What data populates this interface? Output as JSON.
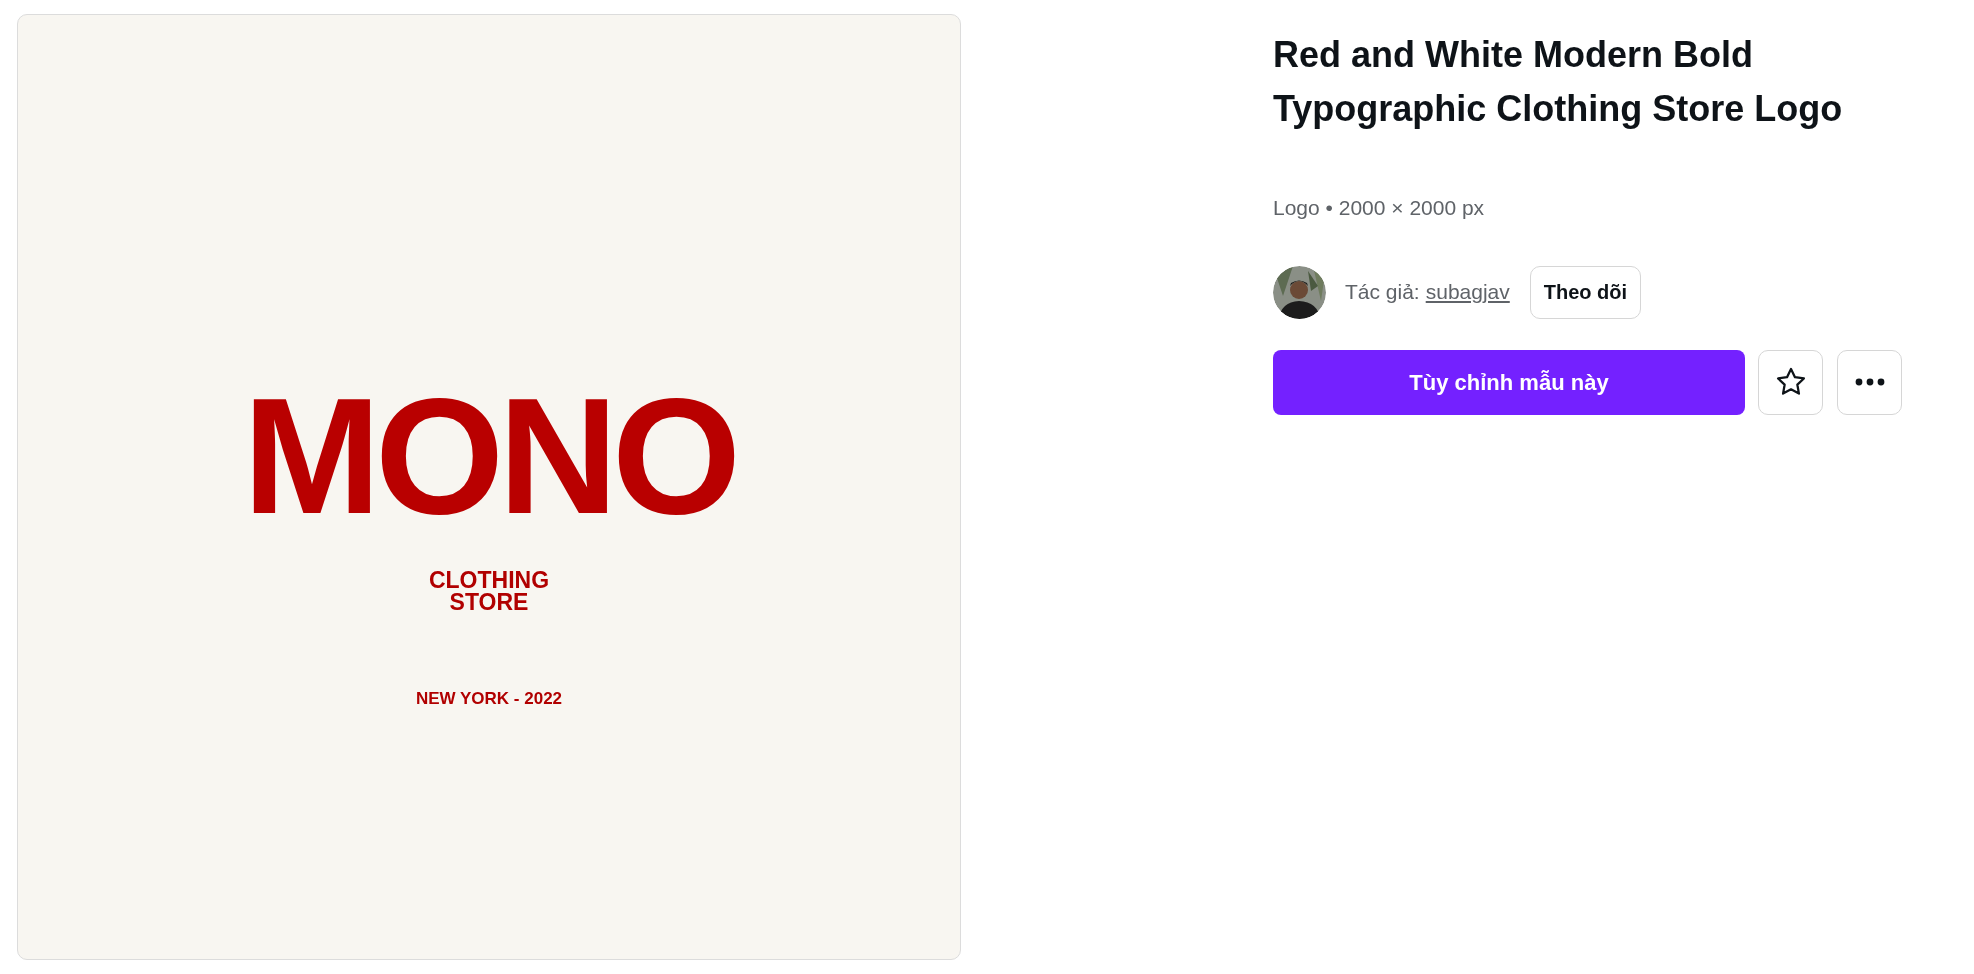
{
  "preview": {
    "wordmark": "MONO",
    "tagline_lines": [
      "CLOTHING",
      "STORE"
    ],
    "location": "NEW YORK - 2022"
  },
  "template": {
    "title": "Red and White Modern Bold Typographic Clothing Store Logo",
    "meta": "Logo • 2000 × 2000 px"
  },
  "author": {
    "label": "Tác giả:",
    "name": "subagjav",
    "follow_button": "Theo dõi"
  },
  "actions": {
    "primary_button": "Tùy chỉnh mẫu này"
  }
}
